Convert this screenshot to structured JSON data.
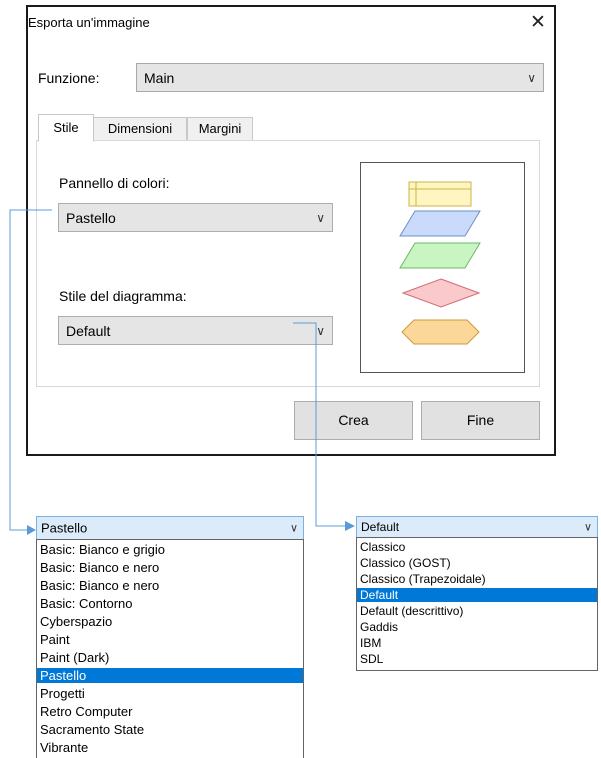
{
  "dialog": {
    "title": "Esporta un'immagine",
    "close_symbol": "✕",
    "function_label": "Funzione:",
    "function_value": "Main",
    "tabs": [
      {
        "label": "Stile",
        "active": true
      },
      {
        "label": "Dimensioni",
        "active": false
      },
      {
        "label": "Margini",
        "active": false
      }
    ],
    "palette_label": "Pannello di colori:",
    "palette_value": "Pastello",
    "diagram_style_label": "Stile del diagramma:",
    "diagram_style_value": "Default",
    "preview_shapes": [
      "process-rectangle",
      "io-parallelogram",
      "io-parallelogram",
      "decision-diamond",
      "preparation-hexagon"
    ],
    "buttons": {
      "create": "Crea",
      "finish": "Fine"
    }
  },
  "palette_dropdown": {
    "selected": "Pastello",
    "items": [
      "Basic: Bianco e grigio",
      "Basic: Bianco e nero",
      "Basic: Bianco e nero",
      "Basic: Contorno",
      "Cyberspazio",
      "Paint",
      "Paint (Dark)",
      "Pastello",
      "Progetti",
      "Retro Computer",
      "Sacramento State",
      "Vibrante"
    ]
  },
  "style_dropdown": {
    "selected": "Default",
    "items": [
      "Classico",
      "Classico (GOST)",
      "Classico (Trapezoidale)",
      "Default",
      "Default (descrittivo)",
      "Gaddis",
      "IBM",
      "SDL"
    ]
  },
  "icons": {
    "chevron": "chevron-down-icon",
    "close": "close-icon"
  },
  "colors": {
    "highlight": "#0078d7",
    "connector": "#5b9bd5",
    "shape_yellow": "#fff5c0",
    "shape_blue": "#c9dafa",
    "shape_green": "#c9f5c3",
    "shape_pink": "#f9c9cb",
    "shape_orange": "#fcd79a"
  }
}
